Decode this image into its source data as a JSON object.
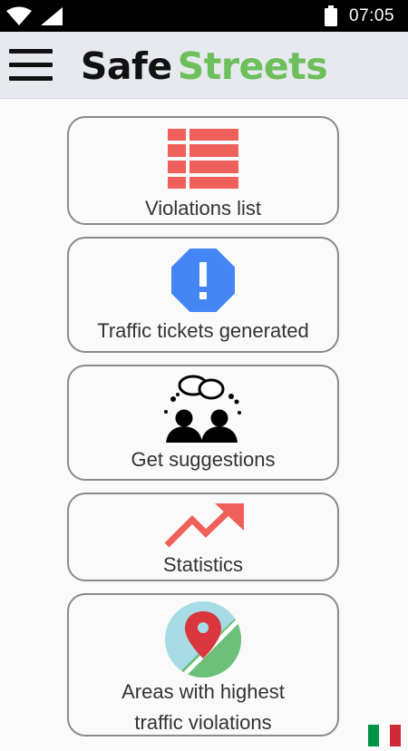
{
  "status_bar": {
    "time": "07:05",
    "icons": [
      "wifi-icon",
      "signal-icon",
      "battery-icon"
    ]
  },
  "app_bar": {
    "menu_icon": "hamburger-menu-icon",
    "logo": {
      "part1": "Safe",
      "part2": "Streets",
      "part1_color": "#111111",
      "part2_color": "#6cbf5a"
    }
  },
  "menu": {
    "items": [
      {
        "label": "Violations list",
        "icon": "list-icon",
        "color": "#f0605a"
      },
      {
        "label": "Traffic tickets generated",
        "icon": "alert-octagon-icon",
        "color": "#4386f4"
      },
      {
        "label": "Get suggestions",
        "icon": "people-thinking-icon",
        "color": "#000000"
      },
      {
        "label": "Statistics",
        "icon": "trend-up-arrow-icon",
        "color": "#f0605a"
      },
      {
        "label_line1": "Areas with highest",
        "label_line2": "traffic violations",
        "icon": "map-pin-icon",
        "color": "#d9363e"
      }
    ]
  },
  "language": {
    "icon": "italy-flag-icon",
    "colors": [
      "#009246",
      "#ffffff",
      "#ce2b37"
    ]
  }
}
